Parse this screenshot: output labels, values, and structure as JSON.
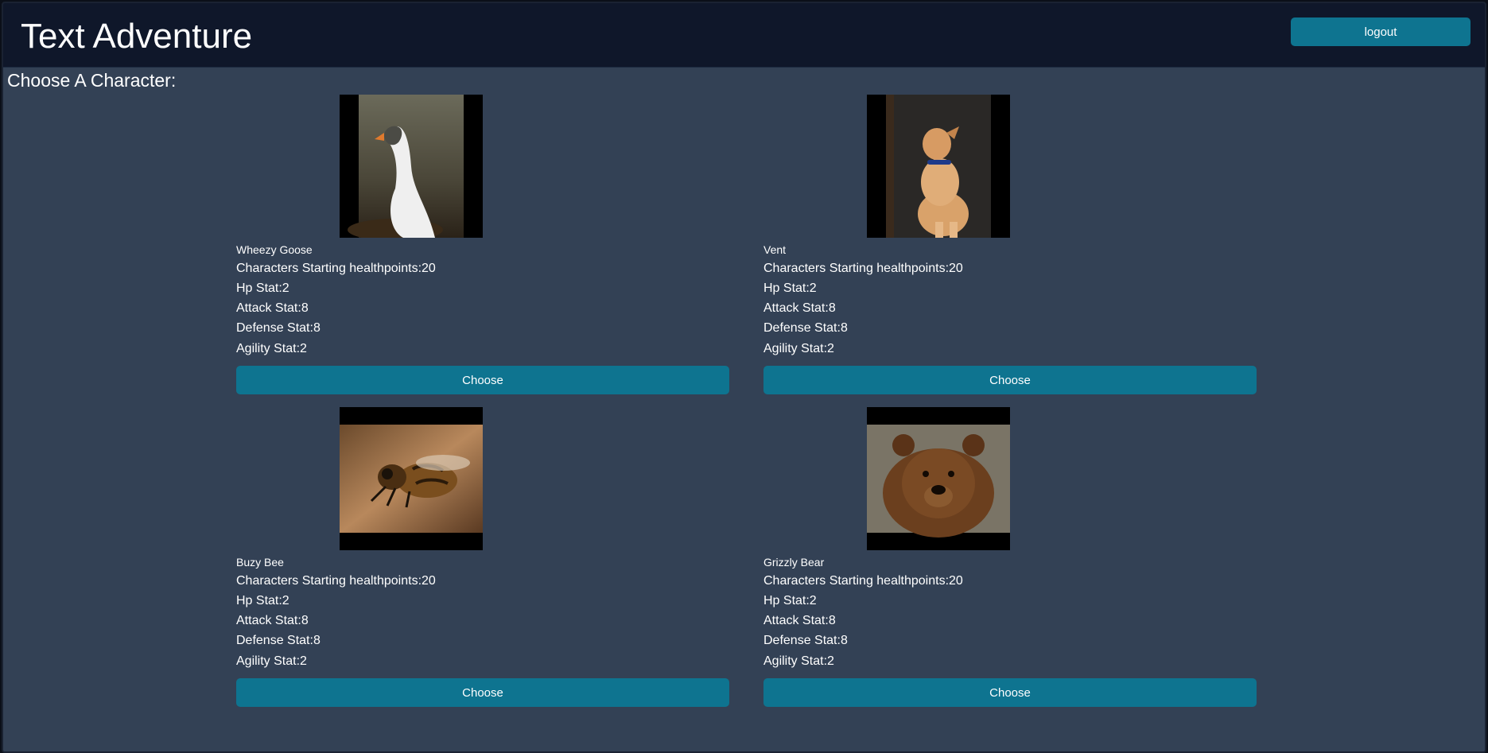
{
  "header": {
    "title": "Text Adventure",
    "logout_label": "logout"
  },
  "page": {
    "subtitle": "Choose A Character:"
  },
  "characters": [
    {
      "name": "Wheezy Goose",
      "image": "goose-photo",
      "hp_line": "Characters Starting healthpoints:20",
      "hp_stat": "Hp Stat:2",
      "attack_stat": "Attack Stat:8",
      "defense_stat": "Defense Stat:8",
      "agility_stat": "Agility Stat:2",
      "choose_label": "Choose"
    },
    {
      "name": "Vent",
      "image": "puppy-photo",
      "hp_line": "Characters Starting healthpoints:20",
      "hp_stat": "Hp Stat:2",
      "attack_stat": "Attack Stat:8",
      "defense_stat": "Defense Stat:8",
      "agility_stat": "Agility Stat:2",
      "choose_label": "Choose"
    },
    {
      "name": "Buzy Bee",
      "image": "bee-photo",
      "hp_line": "Characters Starting healthpoints:20",
      "hp_stat": "Hp Stat:2",
      "attack_stat": "Attack Stat:8",
      "defense_stat": "Defense Stat:8",
      "agility_stat": "Agility Stat:2",
      "choose_label": "Choose"
    },
    {
      "name": "Grizzly Bear",
      "image": "bear-photo",
      "hp_line": "Characters Starting healthpoints:20",
      "hp_stat": "Hp Stat:2",
      "attack_stat": "Attack Stat:8",
      "defense_stat": "Defense Stat:8",
      "agility_stat": "Agility Stat:2",
      "choose_label": "Choose"
    }
  ],
  "colors": {
    "background": "#334155",
    "header": "#0f172a",
    "button": "#0e7490",
    "text": "#ffffff"
  }
}
